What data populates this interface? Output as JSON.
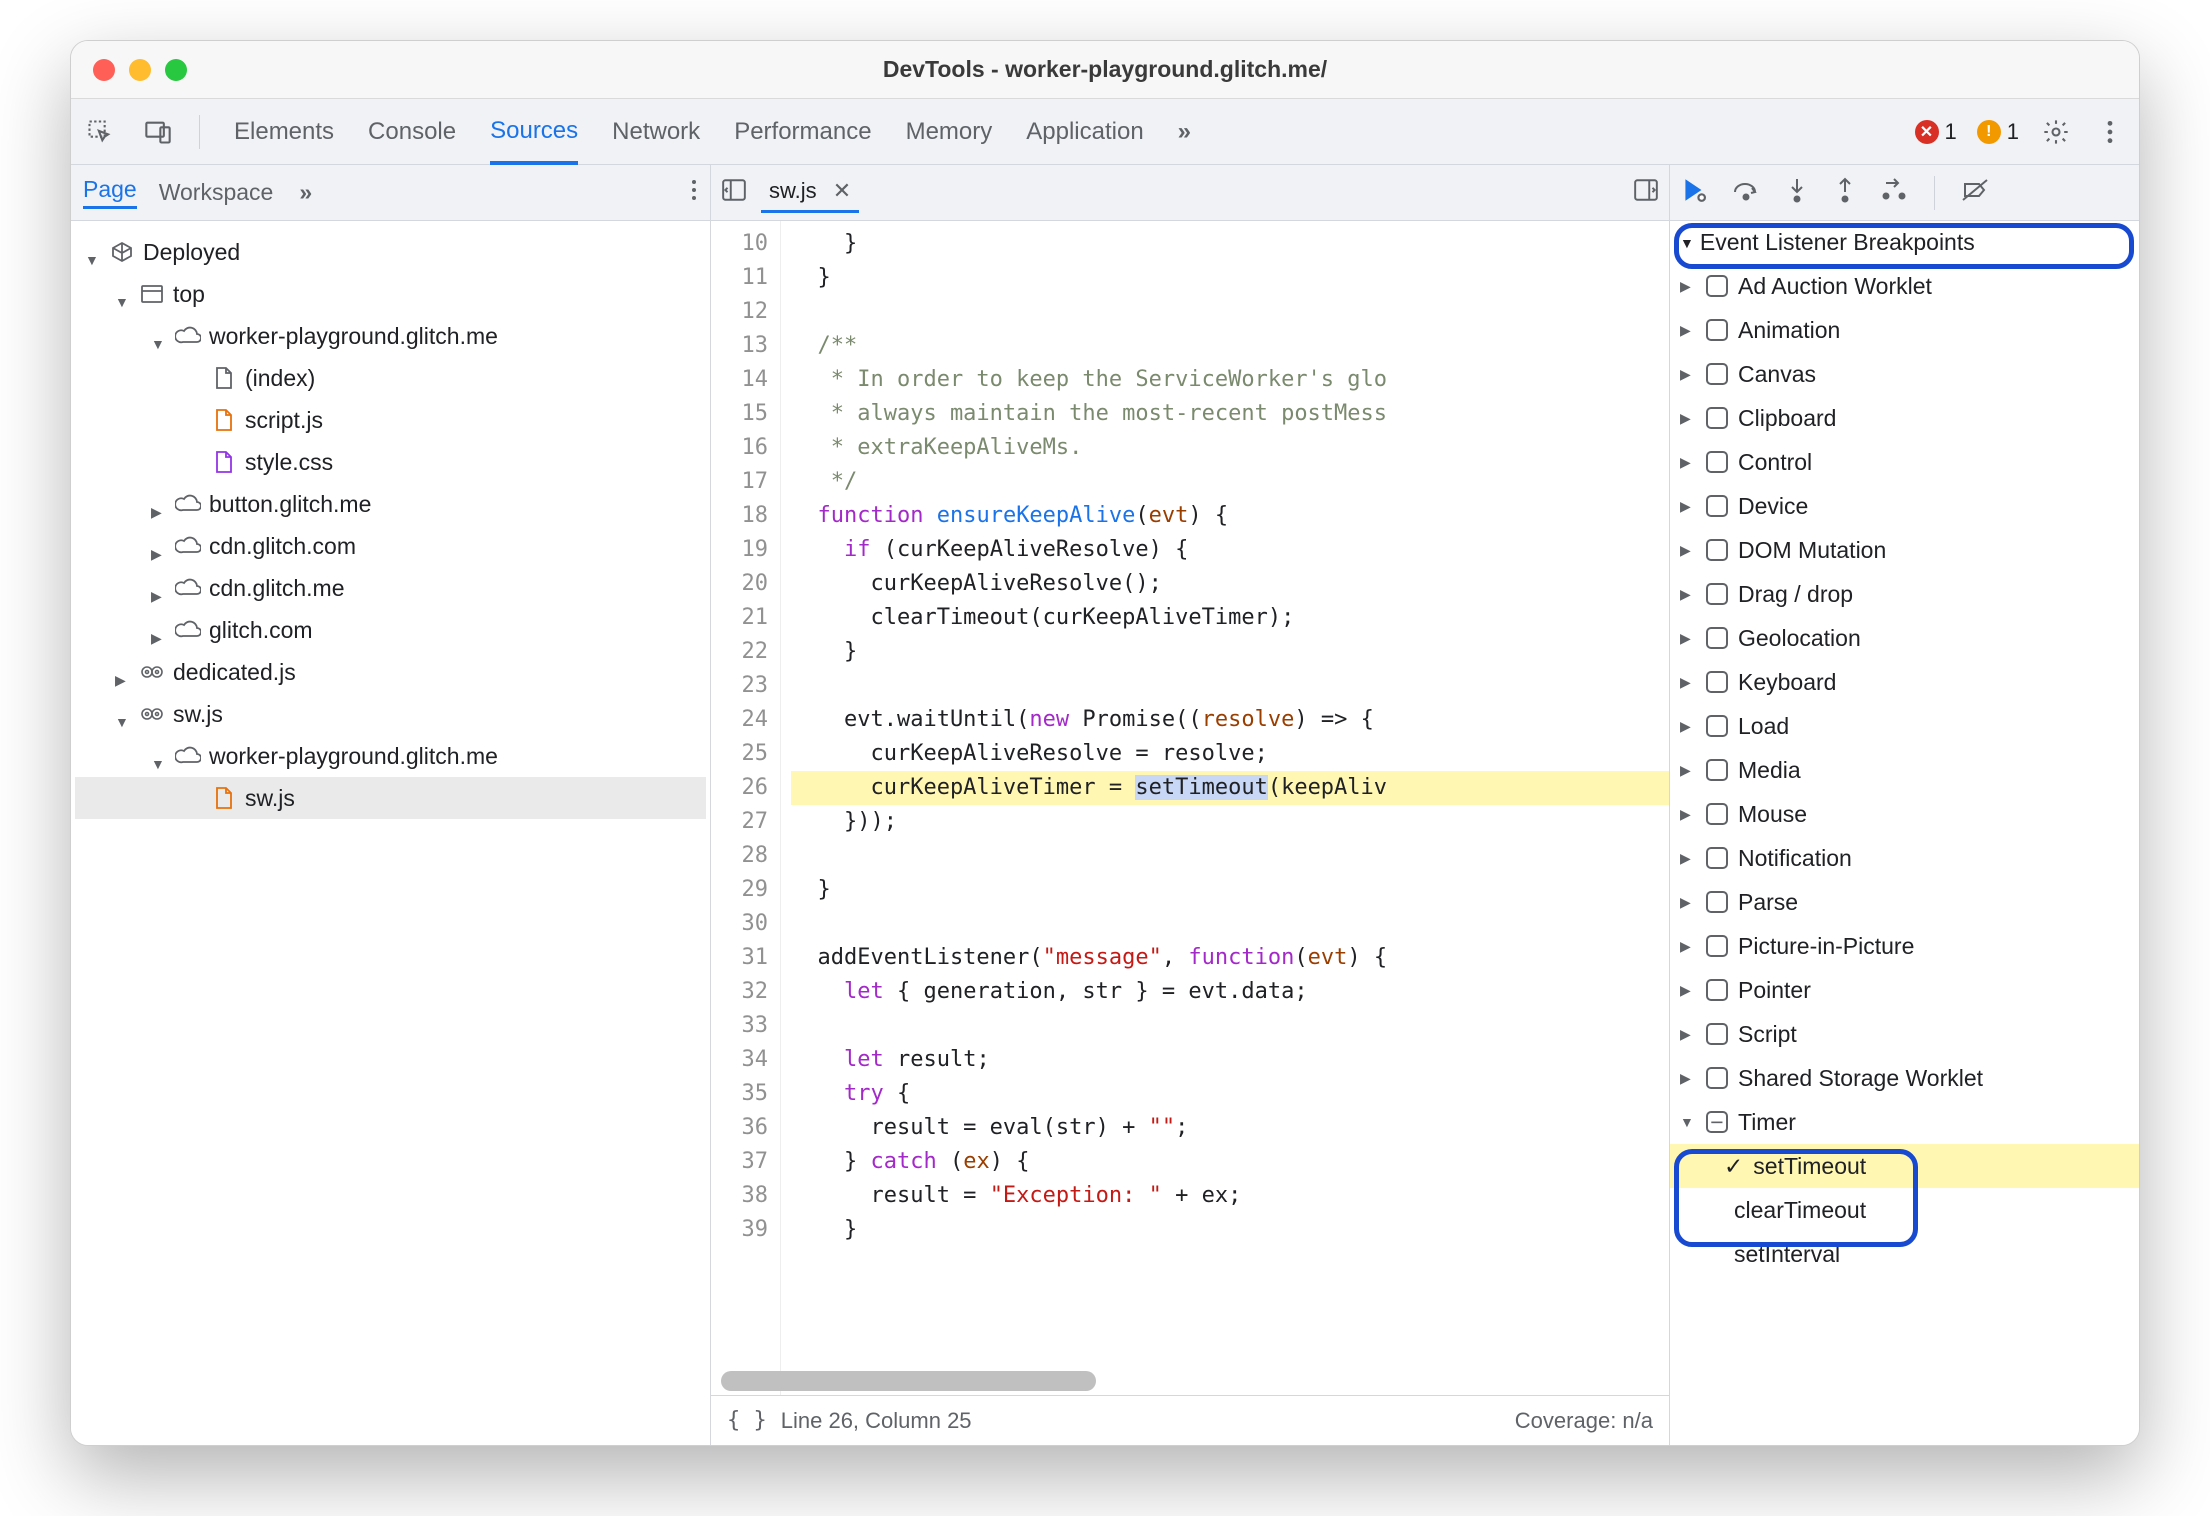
{
  "window": {
    "title": "DevTools - worker-playground.glitch.me/"
  },
  "toolbar": {
    "tabs": [
      "Elements",
      "Console",
      "Sources",
      "Network",
      "Performance",
      "Memory",
      "Application"
    ],
    "active_tab": "Sources",
    "overflow_label": "»",
    "error_count": "1",
    "warn_count": "1"
  },
  "left": {
    "subtabs": [
      "Page",
      "Workspace"
    ],
    "active_subtab": "Page",
    "overflow": "»",
    "tree": {
      "root_label": "Deployed",
      "top_label": "top",
      "domain_label": "worker-playground.glitch.me",
      "index_label": "(index)",
      "scriptjs_label": "script.js",
      "stylecss_label": "style.css",
      "button_label": "button.glitch.me",
      "cdn1_label": "cdn.glitch.com",
      "cdn2_label": "cdn.glitch.me",
      "glitchcom_label": "glitch.com",
      "dedicated_label": "dedicated.js",
      "sw_root_label": "sw.js",
      "sw_domain_label": "worker-playground.glitch.me",
      "sw_file_label": "sw.js"
    }
  },
  "editor": {
    "tab_label": "sw.js",
    "lines": [
      {
        "n": 10,
        "t": "    }"
      },
      {
        "n": 11,
        "t": "  }"
      },
      {
        "n": 12,
        "t": ""
      },
      {
        "n": 13,
        "t": "  /**",
        "cls": "cmt"
      },
      {
        "n": 14,
        "t": "   * In order to keep the ServiceWorker's glo",
        "cls": "cmt"
      },
      {
        "n": 15,
        "t": "   * always maintain the most-recent postMess",
        "cls": "cmt"
      },
      {
        "n": 16,
        "t": "   * extraKeepAliveMs.",
        "cls": "cmt"
      },
      {
        "n": 17,
        "t": "   */",
        "cls": "cmt"
      },
      {
        "n": 18,
        "t": "  §kfunction§ §fensureKeepAlive§(§pevt§) {"
      },
      {
        "n": 19,
        "t": "    §kif§ (curKeepAliveResolve) {"
      },
      {
        "n": 20,
        "t": "      curKeepAliveResolve();"
      },
      {
        "n": 21,
        "t": "      clearTimeout(curKeepAliveTimer);"
      },
      {
        "n": 22,
        "t": "    }"
      },
      {
        "n": 23,
        "t": ""
      },
      {
        "n": 24,
        "t": "    evt.waitUntil(§knew§ Promise((§presolve§) => {"
      },
      {
        "n": 25,
        "t": "      curKeepAliveResolve = resolve;"
      },
      {
        "n": 26,
        "t": "      curKeepAliveTimer = §ssetTimeout§(keepAliv",
        "hl": true
      },
      {
        "n": 27,
        "t": "    }));"
      },
      {
        "n": 28,
        "t": ""
      },
      {
        "n": 29,
        "t": "  }"
      },
      {
        "n": 30,
        "t": ""
      },
      {
        "n": 31,
        "t": "  addEventListener(§q\"message\"§, §kfunction§(§pevt§) {"
      },
      {
        "n": 32,
        "t": "    §klet§ { generation, str } = evt.data;"
      },
      {
        "n": 33,
        "t": ""
      },
      {
        "n": 34,
        "t": "    §klet§ result;"
      },
      {
        "n": 35,
        "t": "    §ktry§ {"
      },
      {
        "n": 36,
        "t": "      result = eval(str) + §q\"\"§;"
      },
      {
        "n": 37,
        "t": "    } §kcatch§ (§pex§) {"
      },
      {
        "n": 38,
        "t": "      result = §q\"Exception: \"§ + ex;"
      },
      {
        "n": 39,
        "t": "    }"
      }
    ],
    "footer_line": "Line 26, Column 25",
    "footer_coverage": "Coverage: n/a"
  },
  "debugger": {
    "section_title": "Event Listener Breakpoints",
    "categories": [
      "Ad Auction Worklet",
      "Animation",
      "Canvas",
      "Clipboard",
      "Control",
      "Device",
      "DOM Mutation",
      "Drag / drop",
      "Geolocation",
      "Keyboard",
      "Load",
      "Media",
      "Mouse",
      "Notification",
      "Parse",
      "Picture-in-Picture",
      "Pointer",
      "Script",
      "Shared Storage Worklet"
    ],
    "timer_label": "Timer",
    "timer_items": [
      {
        "label": "setTimeout",
        "checked": true,
        "hl": true
      },
      {
        "label": "clearTimeout",
        "checked": false
      },
      {
        "label": "setInterval",
        "checked": false
      }
    ]
  }
}
